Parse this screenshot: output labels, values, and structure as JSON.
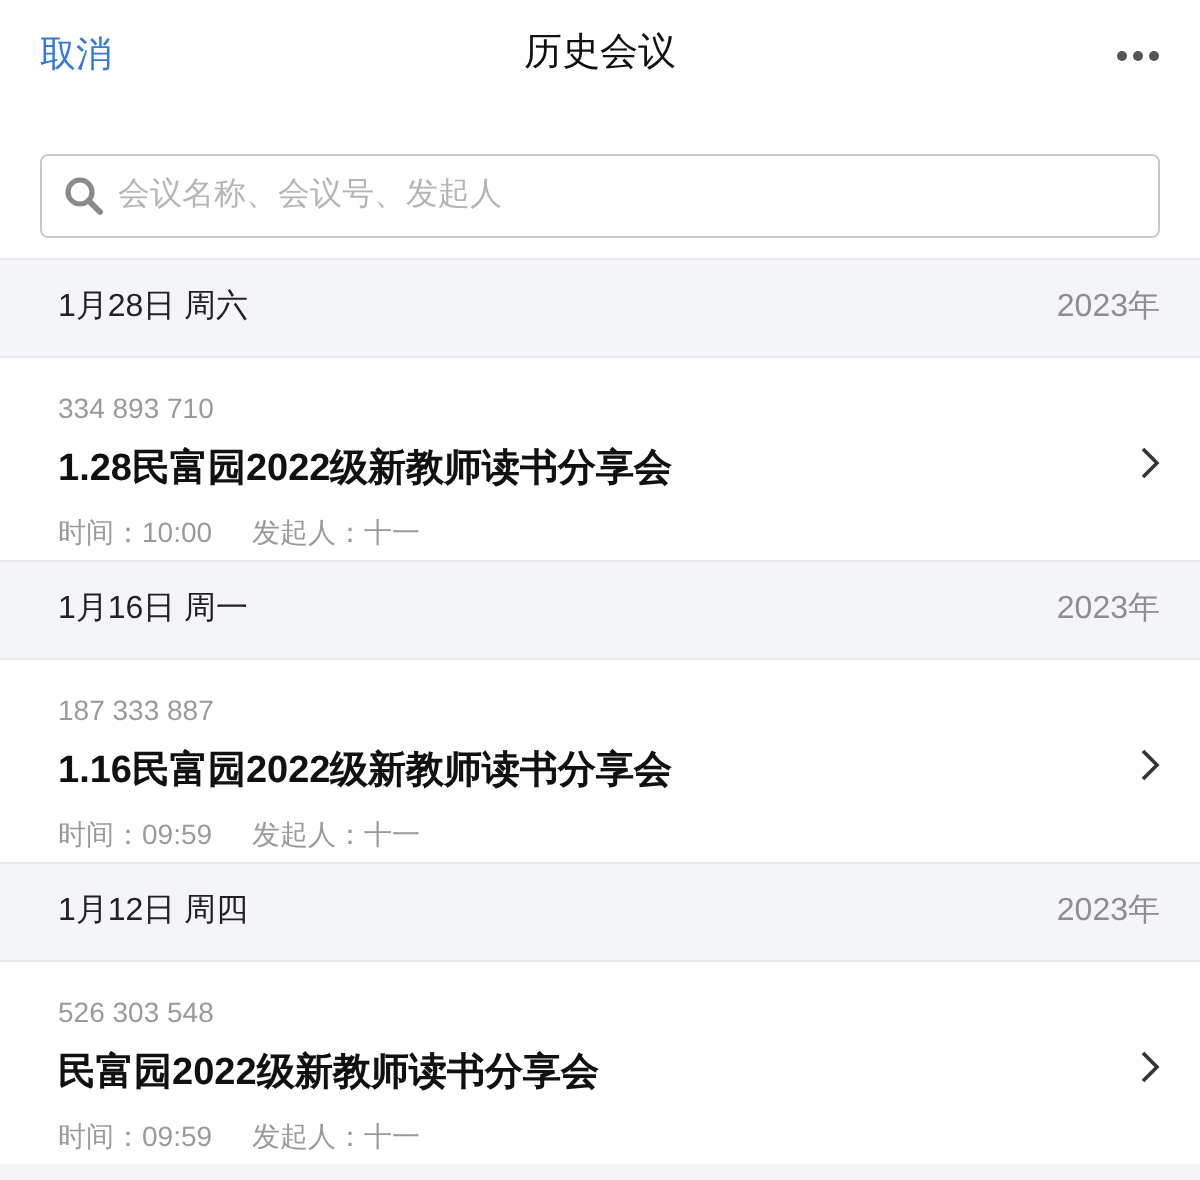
{
  "header": {
    "cancel": "取消",
    "title": "历史会议"
  },
  "search": {
    "placeholder": "会议名称、会议号、发起人"
  },
  "groups": [
    {
      "date": "1月28日 周六",
      "year": "2023年",
      "meetings": [
        {
          "number": "334 893 710",
          "title": "1.28民富园2022级新教师读书分享会",
          "time": "时间：10:00",
          "host": "发起人：十一"
        }
      ]
    },
    {
      "date": "1月16日 周一",
      "year": "2023年",
      "meetings": [
        {
          "number": "187 333 887",
          "title": "1.16民富园2022级新教师读书分享会",
          "time": "时间：09:59",
          "host": "发起人：十一"
        }
      ]
    },
    {
      "date": "1月12日 周四",
      "year": "2023年",
      "meetings": [
        {
          "number": "526 303 548",
          "title": "民富园2022级新教师读书分享会",
          "time": "时间：09:59",
          "host": "发起人：十一"
        }
      ]
    }
  ]
}
